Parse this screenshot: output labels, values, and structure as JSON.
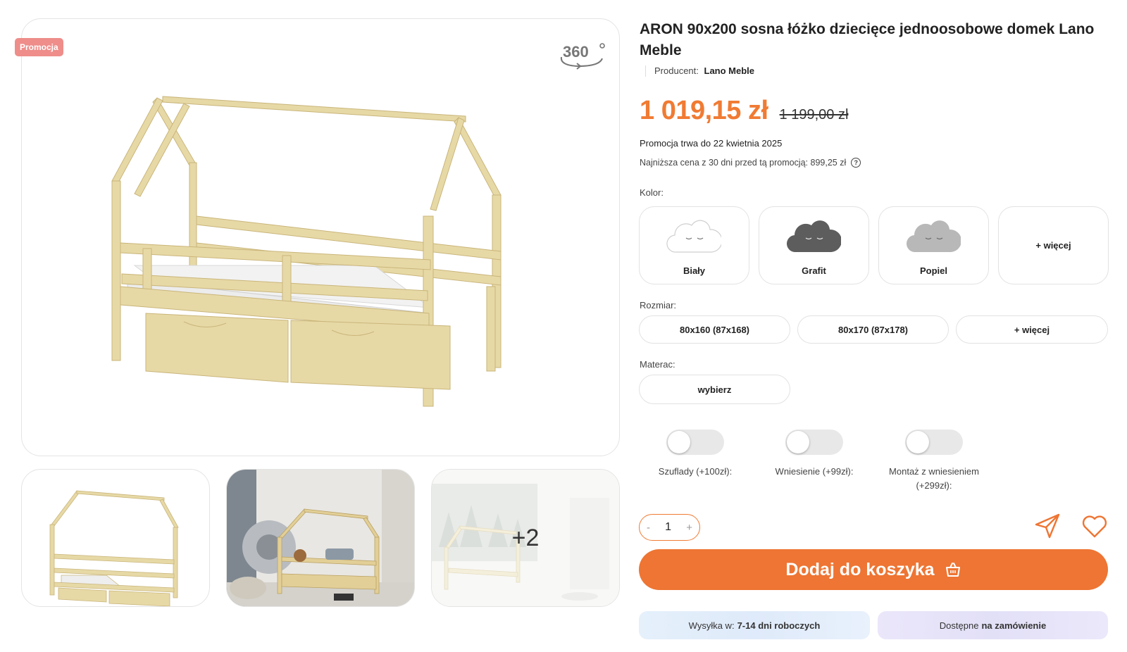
{
  "gallery": {
    "promo_badge": "Promocja",
    "icon_360": "360",
    "more_photos": "+2"
  },
  "product": {
    "title": "ARON 90x200 sosna łóżko dziecięce jednoosobowe domek Lano Meble",
    "producer_label": "Producent:",
    "producer_name": "Lano Meble",
    "price_now": "1 019,15 zł",
    "price_old": "1 199,00 zł",
    "promo_until": "Promocja trwa do 22 kwietnia 2025",
    "lowest_price": "Najniższa cena z 30 dni przed tą promocją: 899,25 zł"
  },
  "color": {
    "label": "Kolor:",
    "options": [
      {
        "name": "Biały",
        "swatch": "#ffffff"
      },
      {
        "name": "Grafit",
        "swatch": "#5d5d5d"
      },
      {
        "name": "Popiel",
        "swatch": "#b8b8b8"
      }
    ],
    "more": "+ więcej"
  },
  "size": {
    "label": "Rozmiar:",
    "options": [
      "80x160 (87x168)",
      "80x170 (87x178)"
    ],
    "more": "+ więcej"
  },
  "mattress": {
    "label": "Materac:",
    "select": "wybierz"
  },
  "toggles": [
    {
      "label": "Szuflady (+100zł):",
      "on": false
    },
    {
      "label": "Wniesienie (+99zł):",
      "on": false
    },
    {
      "label": "Montaż z wniesieniem (+299zł):",
      "on": false
    }
  ],
  "quantity": {
    "minus": "-",
    "value": "1",
    "plus": "+"
  },
  "cart": {
    "button": "Dodaj do koszyka"
  },
  "shipping": {
    "label": "Wysyłka w:",
    "value": "7-14 dni roboczych"
  },
  "availability": {
    "label": "Dostępne",
    "value": "na zamówienie"
  },
  "colors": {
    "accent": "#ee7533",
    "promo_badge": "#ee8d8a",
    "wood": "#e7d9a6"
  }
}
